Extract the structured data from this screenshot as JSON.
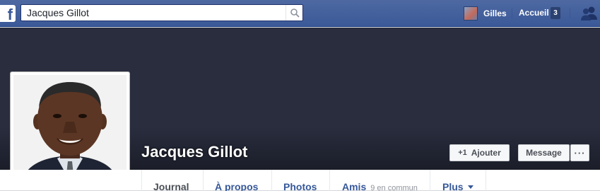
{
  "topbar": {
    "logo": "f",
    "search_value": "Jacques Gillot",
    "user_name": "Gilles",
    "home_label": "Accueil",
    "home_badge": "3"
  },
  "profile": {
    "name": "Jacques Gillot"
  },
  "actions": {
    "add_label": "Ajouter",
    "add_icon": "+1",
    "message_label": "Message",
    "more_label": "···"
  },
  "tabs": [
    {
      "label": "Journal",
      "active": true
    },
    {
      "label": "À propos"
    },
    {
      "label": "Photos"
    },
    {
      "label": "Amis",
      "sub": "9 en commun"
    },
    {
      "label": "Plus"
    }
  ],
  "colors": {
    "brand": "#3b5998",
    "cover": "#292d3e",
    "link": "#365899"
  }
}
